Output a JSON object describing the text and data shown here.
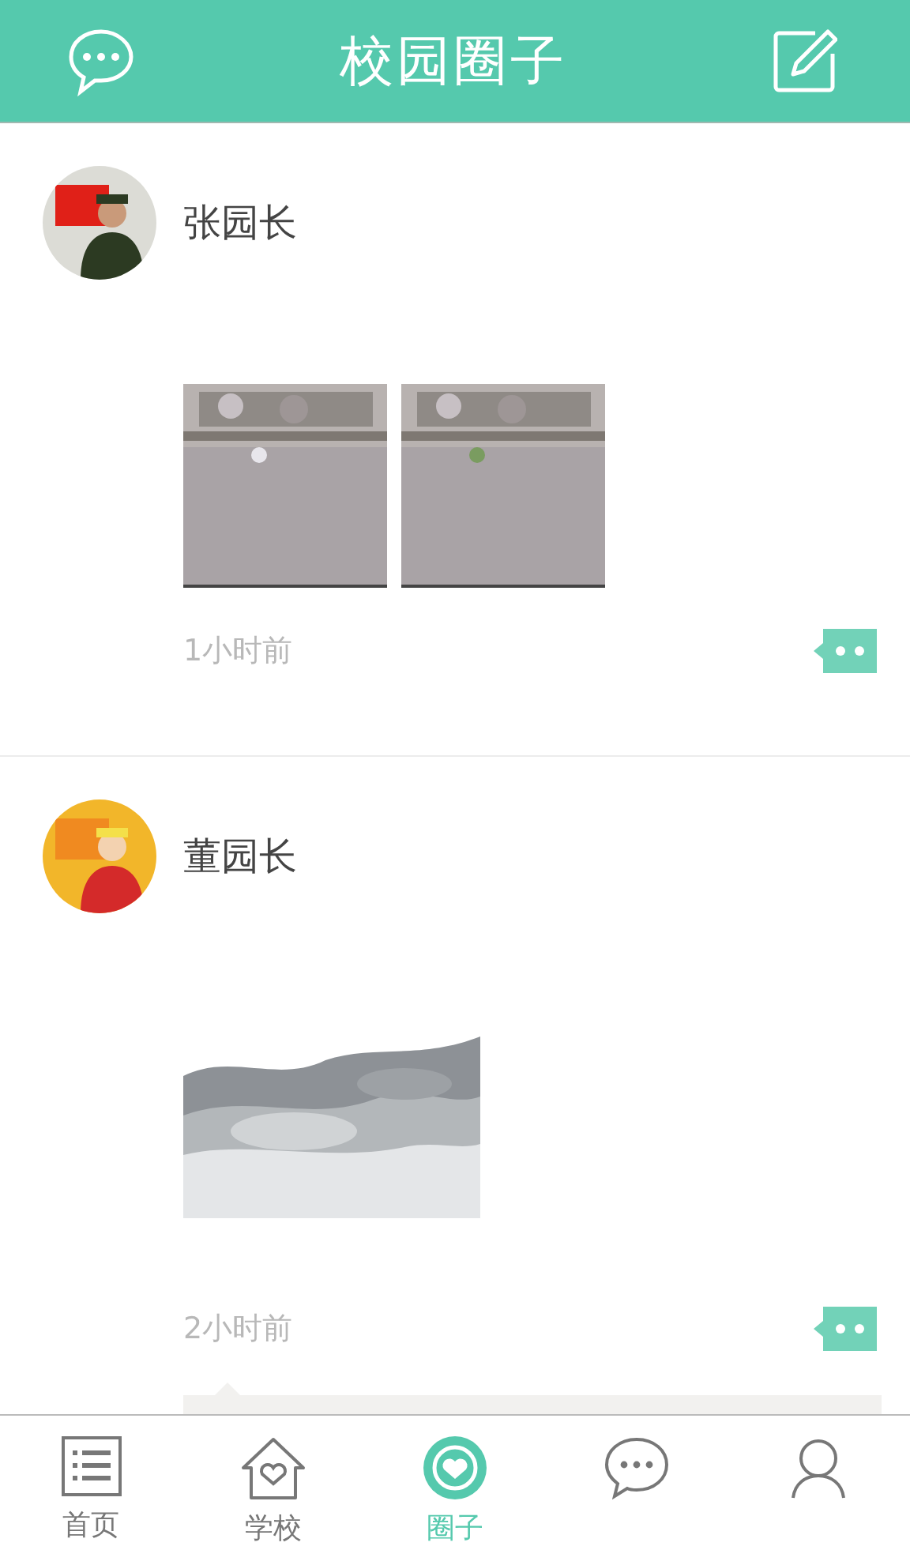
{
  "header": {
    "title": "校园圈子"
  },
  "posts": [
    {
      "author": "张园长",
      "time": "1小时前",
      "has_comments": false
    },
    {
      "author": "董园长",
      "time": "2小时前",
      "has_comments": true
    }
  ],
  "tabs": [
    {
      "kind": "list",
      "label": "首页",
      "selected": false
    },
    {
      "kind": "house",
      "label": "学校",
      "selected": false
    },
    {
      "kind": "circle",
      "label": "圈子",
      "selected": true
    },
    {
      "kind": "chat",
      "selected": false
    },
    {
      "kind": "person",
      "selected": false
    }
  ]
}
